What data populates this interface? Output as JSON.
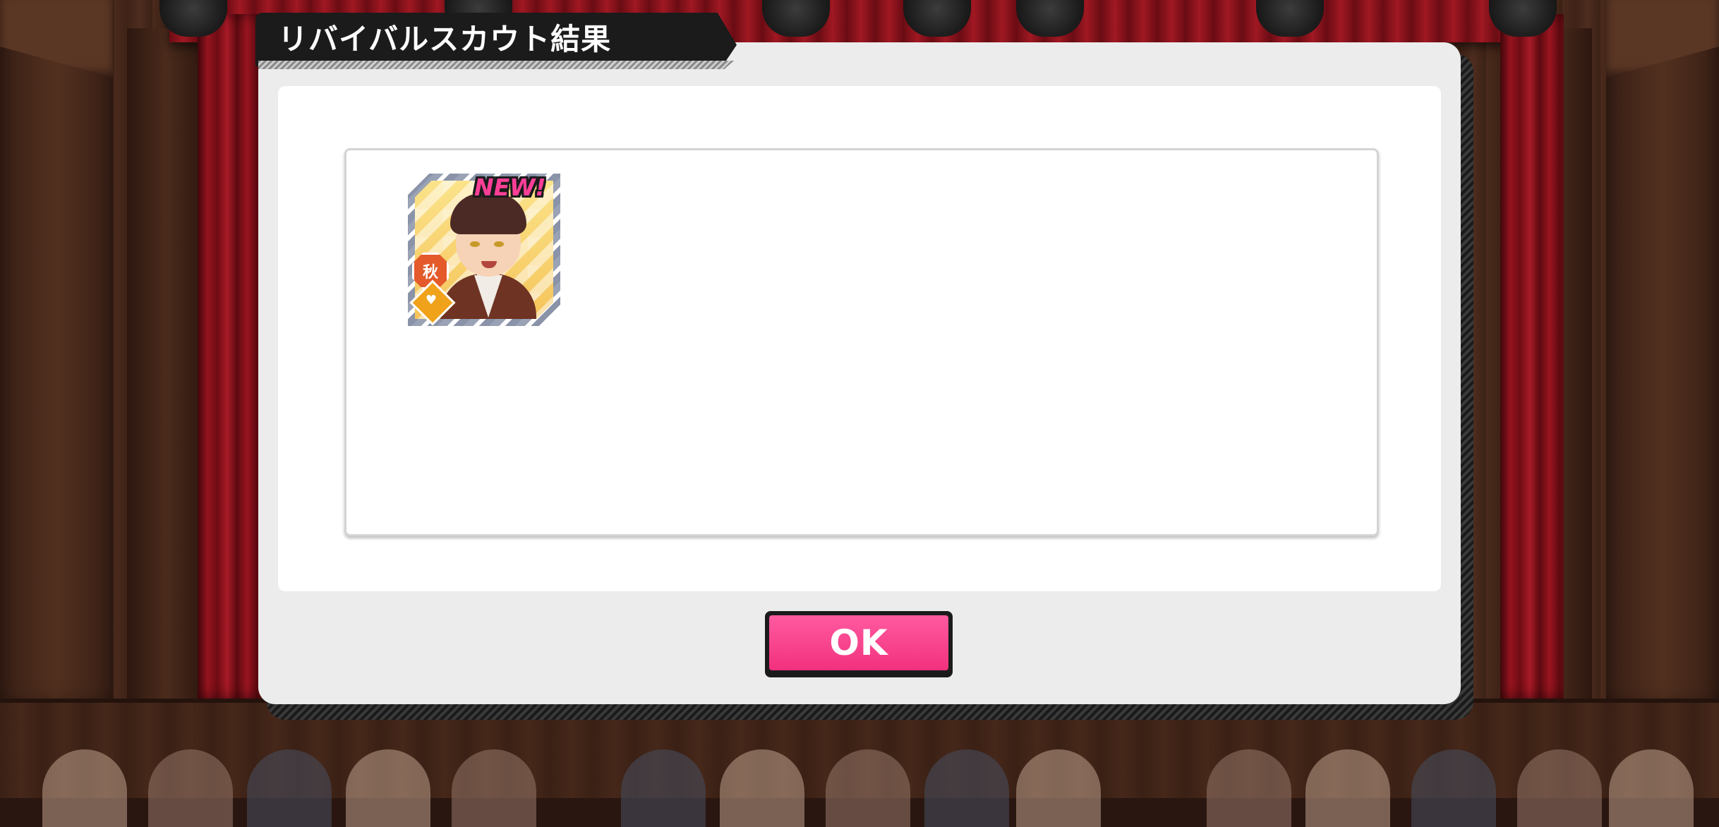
{
  "dialog": {
    "title": "リバイバルスカウト結果"
  },
  "result_card": {
    "new_badge": "NEW!",
    "season_badge": "秋",
    "rarity_icon": "heart-diamond-icon",
    "character_icon": "character-portrait"
  },
  "buttons": {
    "ok_label": "OK"
  },
  "colors": {
    "accent_pink": "#f2317d",
    "title_tab": "#1b1b1b",
    "season_badge": "#e45a2b",
    "rarity_badge": "#f0a21b"
  }
}
